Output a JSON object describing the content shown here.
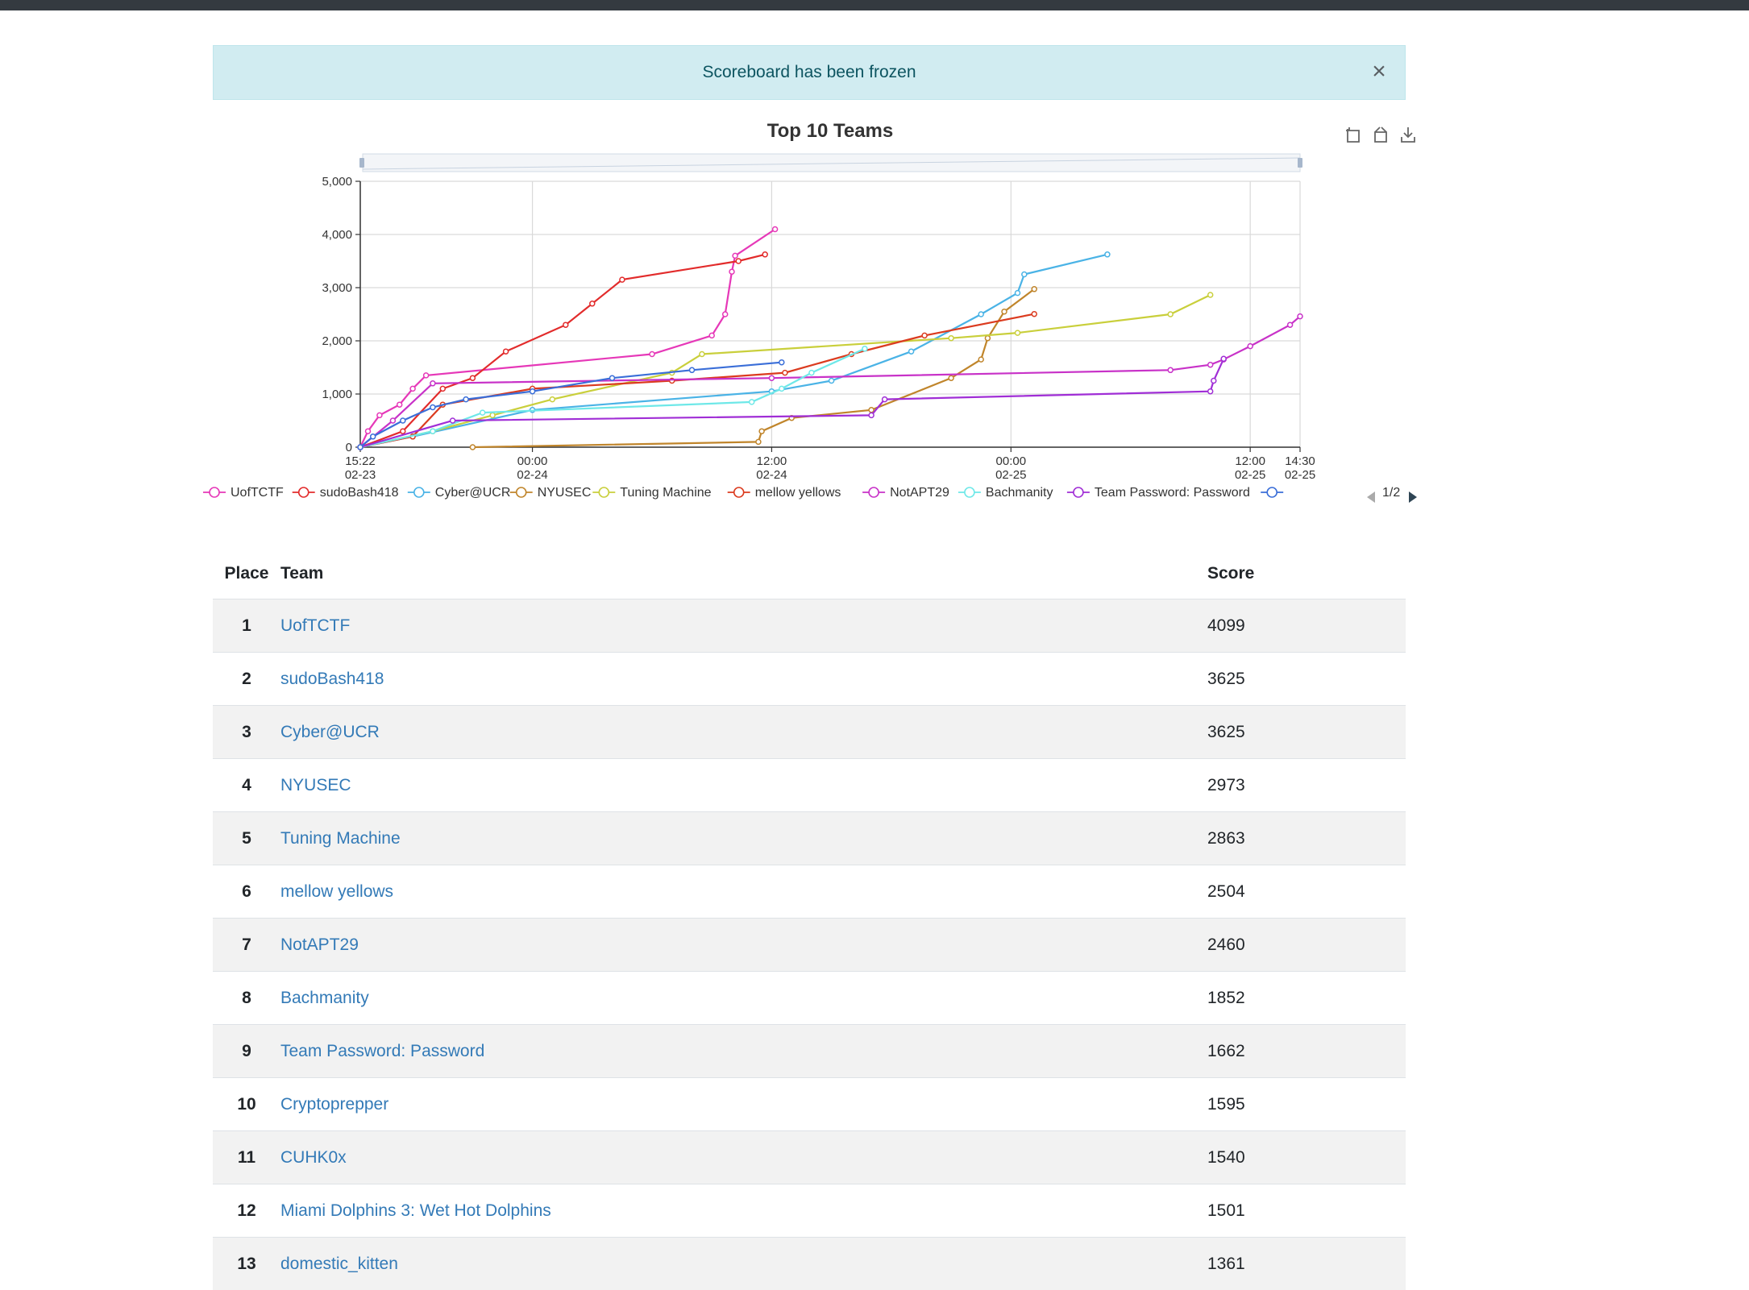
{
  "alert": {
    "message": "Scoreboard has been frozen",
    "close_label": "×"
  },
  "colors": {
    "UofTCTF": "#e638b8",
    "sudoBash418": "#e22b2b",
    "Cyber@UCR": "#4ab3e6",
    "NYUSEC": "#c0852b",
    "Tuning Machine": "#c9cf3b",
    "mellow yellows": "#db3b1f",
    "NotAPT29": "#c832c8",
    "Bachmanity": "#6ee8e8",
    "Team Password: Password": "#a02ed6",
    "Cryptoprepper": "#3a6ed8"
  },
  "chart_data": {
    "type": "line",
    "title": "Top 10 Teams",
    "x_ticks": [
      {
        "time": "15:22",
        "date": "02-23"
      },
      {
        "time": "00:00",
        "date": "02-24"
      },
      {
        "time": "12:00",
        "date": "02-24"
      },
      {
        "time": "00:00",
        "date": "02-25"
      },
      {
        "time": "12:00",
        "date": "02-25"
      },
      {
        "time": "14:30",
        "date": "02-25"
      }
    ],
    "y_ticks": [
      "0",
      "1,000",
      "2,000",
      "3,000",
      "4,000",
      "5,000"
    ],
    "xlim": [
      "2020-02-23 15:22",
      "2020-02-25 14:30"
    ],
    "ylim": [
      0,
      5000
    ],
    "grid": true,
    "legend_position": "bottom",
    "legend_page": "1/2",
    "series": [
      {
        "name": "UofTCTF",
        "points": [
          [
            "02-23 15:22",
            0
          ],
          [
            "02-23 15:45",
            300
          ],
          [
            "02-23 16:20",
            600
          ],
          [
            "02-23 17:20",
            800
          ],
          [
            "02-23 18:00",
            1100
          ],
          [
            "02-23 18:40",
            1350
          ],
          [
            "02-24 06:00",
            1750
          ],
          [
            "02-24 09:00",
            2100
          ],
          [
            "02-24 09:40",
            2500
          ],
          [
            "02-24 10:00",
            3300
          ],
          [
            "02-24 10:10",
            3600
          ],
          [
            "02-24 12:10",
            4099
          ]
        ]
      },
      {
        "name": "sudoBash418",
        "points": [
          [
            "02-23 15:22",
            0
          ],
          [
            "02-23 17:30",
            300
          ],
          [
            "02-23 19:30",
            1100
          ],
          [
            "02-23 21:00",
            1300
          ],
          [
            "02-23 22:40",
            1800
          ],
          [
            "02-24 01:40",
            2300
          ],
          [
            "02-24 03:00",
            2700
          ],
          [
            "02-24 04:30",
            3150
          ],
          [
            "02-24 10:20",
            3500
          ],
          [
            "02-24 11:40",
            3625
          ]
        ]
      },
      {
        "name": "Cyber@UCR",
        "points": [
          [
            "02-23 15:22",
            0
          ],
          [
            "02-23 18:00",
            200
          ],
          [
            "02-24 00:00",
            700
          ],
          [
            "02-24 12:00",
            1050
          ],
          [
            "02-24 15:00",
            1250
          ],
          [
            "02-24 19:00",
            1800
          ],
          [
            "02-24 22:30",
            2500
          ],
          [
            "02-25 00:20",
            2900
          ],
          [
            "02-25 00:40",
            3250
          ],
          [
            "02-25 04:50",
            3625
          ]
        ]
      },
      {
        "name": "NYUSEC",
        "points": [
          [
            "02-23 21:00",
            0
          ],
          [
            "02-24 11:20",
            100
          ],
          [
            "02-24 11:30",
            300
          ],
          [
            "02-24 13:00",
            550
          ],
          [
            "02-24 17:00",
            700
          ],
          [
            "02-24 21:00",
            1300
          ],
          [
            "02-24 22:30",
            1650
          ],
          [
            "02-24 22:50",
            2050
          ],
          [
            "02-24 23:40",
            2550
          ],
          [
            "02-25 01:10",
            2973
          ]
        ]
      },
      {
        "name": "Tuning Machine",
        "points": [
          [
            "02-23 15:22",
            0
          ],
          [
            "02-23 19:00",
            300
          ],
          [
            "02-23 22:00",
            600
          ],
          [
            "02-24 01:00",
            900
          ],
          [
            "02-24 07:00",
            1400
          ],
          [
            "02-24 08:30",
            1750
          ],
          [
            "02-24 21:00",
            2050
          ],
          [
            "02-25 00:20",
            2150
          ],
          [
            "02-25 08:00",
            2500
          ],
          [
            "02-25 10:00",
            2863
          ]
        ]
      },
      {
        "name": "mellow yellows",
        "points": [
          [
            "02-23 15:22",
            0
          ],
          [
            "02-23 18:00",
            200
          ],
          [
            "02-23 19:30",
            800
          ],
          [
            "02-24 00:00",
            1100
          ],
          [
            "02-24 07:00",
            1250
          ],
          [
            "02-24 12:40",
            1400
          ],
          [
            "02-24 16:00",
            1750
          ],
          [
            "02-24 19:40",
            2100
          ],
          [
            "02-25 01:10",
            2504
          ]
        ]
      },
      {
        "name": "NotAPT29",
        "points": [
          [
            "02-23 15:22",
            0
          ],
          [
            "02-23 17:00",
            500
          ],
          [
            "02-23 19:00",
            1200
          ],
          [
            "02-24 12:00",
            1300
          ],
          [
            "02-25 08:00",
            1450
          ],
          [
            "02-25 10:00",
            1550
          ],
          [
            "02-25 10:40",
            1650
          ],
          [
            "02-25 12:00",
            1900
          ],
          [
            "02-25 14:00",
            2300
          ],
          [
            "02-25 14:30",
            2460
          ]
        ]
      },
      {
        "name": "Bachmanity",
        "points": [
          [
            "02-23 15:22",
            0
          ],
          [
            "02-23 19:00",
            300
          ],
          [
            "02-23 21:30",
            650
          ],
          [
            "02-24 11:00",
            850
          ],
          [
            "02-24 12:30",
            1100
          ],
          [
            "02-24 14:00",
            1400
          ],
          [
            "02-24 16:40",
            1852
          ]
        ]
      },
      {
        "name": "Team Password: Password",
        "points": [
          [
            "02-23 15:22",
            0
          ],
          [
            "02-23 20:00",
            500
          ],
          [
            "02-24 17:00",
            600
          ],
          [
            "02-24 17:40",
            900
          ],
          [
            "02-25 10:00",
            1050
          ],
          [
            "02-25 10:10",
            1250
          ],
          [
            "02-25 10:40",
            1662
          ]
        ]
      },
      {
        "name": "Cryptoprepper",
        "points": [
          [
            "02-23 15:22",
            0
          ],
          [
            "02-23 16:00",
            200
          ],
          [
            "02-23 17:30",
            500
          ],
          [
            "02-23 19:00",
            750
          ],
          [
            "02-23 20:40",
            900
          ],
          [
            "02-24 00:00",
            1050
          ],
          [
            "02-24 04:00",
            1300
          ],
          [
            "02-24 08:00",
            1450
          ],
          [
            "02-24 12:30",
            1595
          ]
        ]
      }
    ]
  },
  "table": {
    "headers": {
      "place": "Place",
      "team": "Team",
      "score": "Score"
    },
    "rows": [
      {
        "place": "1",
        "team": "UofTCTF",
        "score": "4099"
      },
      {
        "place": "2",
        "team": "sudoBash418",
        "score": "3625"
      },
      {
        "place": "3",
        "team": "Cyber@UCR",
        "score": "3625"
      },
      {
        "place": "4",
        "team": "NYUSEC",
        "score": "2973"
      },
      {
        "place": "5",
        "team": "Tuning Machine",
        "score": "2863"
      },
      {
        "place": "6",
        "team": "mellow yellows",
        "score": "2504"
      },
      {
        "place": "7",
        "team": "NotAPT29",
        "score": "2460"
      },
      {
        "place": "8",
        "team": "Bachmanity",
        "score": "1852"
      },
      {
        "place": "9",
        "team": "Team Password: Password",
        "score": "1662"
      },
      {
        "place": "10",
        "team": "Cryptoprepper",
        "score": "1595"
      },
      {
        "place": "11",
        "team": "CUHK0x",
        "score": "1540"
      },
      {
        "place": "12",
        "team": "Miami Dolphins 3: Wet Hot Dolphins",
        "score": "1501"
      },
      {
        "place": "13",
        "team": "domestic_kitten",
        "score": "1361"
      }
    ]
  },
  "toolbox": [
    "zoom-icon",
    "zoom-reset-icon",
    "download-icon"
  ]
}
